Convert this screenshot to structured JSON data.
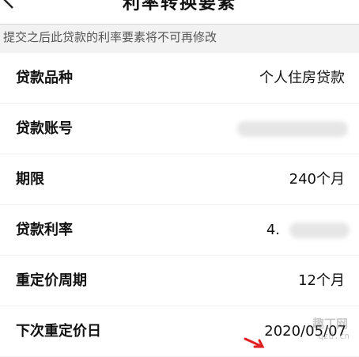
{
  "header": {
    "title": "利率转换要素"
  },
  "notice": "提交之后此贷款的利率要素将不可再修改",
  "rows": [
    {
      "label": "贷款品种",
      "value": "个人住房贷款"
    },
    {
      "label": "贷款账号",
      "value": ""
    },
    {
      "label": "期限",
      "value": "240个月"
    },
    {
      "label": "贷款利率",
      "value": "4."
    },
    {
      "label": "重定价周期",
      "value": "12个月"
    },
    {
      "label": "下次重定价日",
      "value": "2020/05/07"
    }
  ],
  "watermark": {
    "top": "趣丁网",
    "bottom": "qzd.cn"
  },
  "colors": {
    "background": "#f2f2f2",
    "card": "#ffffff",
    "arrow": "#e02020"
  }
}
